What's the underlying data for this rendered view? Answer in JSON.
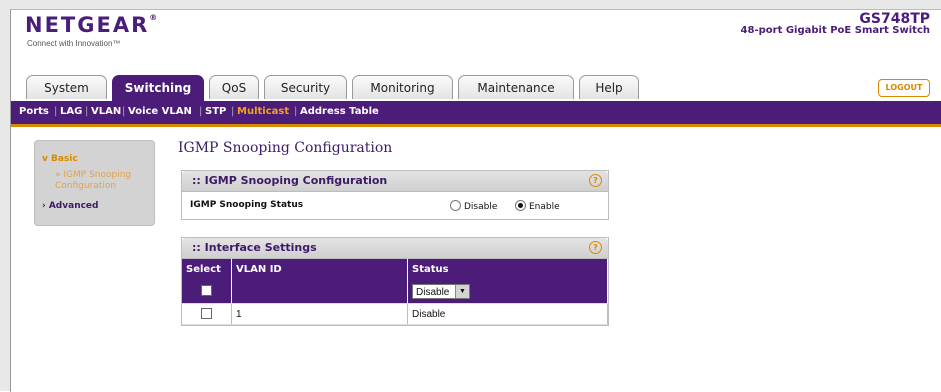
{
  "brand": {
    "name": "NETGEAR",
    "tagline": "Connect with Innovation™",
    "model": "GS748TP",
    "model_desc": "48-port Gigabit PoE Smart Switch"
  },
  "tabs": [
    "System",
    "Switching",
    "QoS",
    "Security",
    "Monitoring",
    "Maintenance",
    "Help"
  ],
  "active_tab": "Switching",
  "logout_label": "LOGOUT",
  "subnav": [
    "Ports",
    "LAG",
    "VLAN",
    "Voice VLAN",
    "STP",
    "Multicast",
    "Address Table"
  ],
  "active_subnav": "Multicast",
  "sidebar": {
    "basic": "Basic",
    "basic_item": "» IGMP Snooping Configuration",
    "advanced": "Advanced"
  },
  "page_title": "IGMP Snooping Configuration",
  "panel1": {
    "title": "IGMP Snooping Configuration",
    "row_label": "IGMP Snooping Status",
    "options": [
      "Disable",
      "Enable"
    ],
    "selected": "Enable"
  },
  "panel2": {
    "title": "Interface Settings",
    "columns": [
      "Select",
      "VLAN ID",
      "Status"
    ],
    "edit_row": {
      "status_select": "Disable"
    },
    "rows": [
      {
        "vlan_id": "1",
        "status": "Disable"
      }
    ]
  },
  "colors": {
    "brand_purple": "#4b1d78",
    "accent_orange": "#d68a00"
  }
}
